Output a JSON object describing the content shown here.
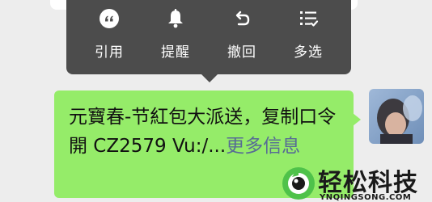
{
  "context_menu": {
    "items": [
      {
        "label": "引用",
        "icon": "quote-icon"
      },
      {
        "label": "提醒",
        "icon": "bell-icon"
      },
      {
        "label": "撤回",
        "icon": "undo-icon"
      },
      {
        "label": "多选",
        "icon": "multi-select-icon"
      }
    ]
  },
  "message": {
    "text": "元寶春-节紅包大派送，复制口令開 CZ2579 Vu:/...",
    "more_link": "更多信息",
    "bubble_color": "#95ec69"
  },
  "watermark": {
    "name": "轻松科技",
    "url": "YNQINGSONG.COM"
  },
  "colors": {
    "menu_bg": "#4c4c4c",
    "page_bg": "#ededed",
    "link": "#576b95"
  }
}
